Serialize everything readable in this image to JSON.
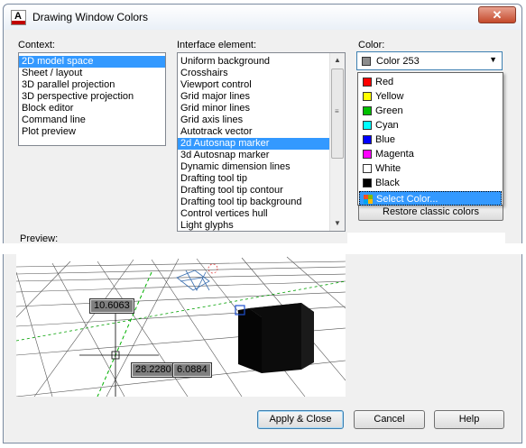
{
  "window": {
    "title": "Drawing Window Colors",
    "close_glyph": "✕",
    "app_icon": "autocad-icon",
    "app_letter": "A"
  },
  "context": {
    "label": "Context:",
    "items": [
      "2D model space",
      "Sheet / layout",
      "3D parallel projection",
      "3D perspective projection",
      "Block editor",
      "Command line",
      "Plot preview"
    ],
    "selected_index": 0
  },
  "interface": {
    "label": "Interface element:",
    "items": [
      "Uniform background",
      "Crosshairs",
      "Viewport control",
      "Grid major lines",
      "Grid minor lines",
      "Grid axis lines",
      "Autotrack vector",
      "2d Autosnap marker",
      "3d Autosnap marker",
      "Dynamic dimension lines",
      "Drafting tool tip",
      "Drafting tool tip contour",
      "Drafting tool tip background",
      "Control vertices hull",
      "Light glyphs"
    ],
    "selected_index": 7
  },
  "color": {
    "label": "Color:",
    "selected": "Color 253",
    "selected_hex": "#8c8c8c",
    "options": [
      {
        "label": "Red",
        "hex": "#ff0000"
      },
      {
        "label": "Yellow",
        "hex": "#ffff00"
      },
      {
        "label": "Green",
        "hex": "#00c000"
      },
      {
        "label": "Cyan",
        "hex": "#00ffff"
      },
      {
        "label": "Blue",
        "hex": "#0000ff"
      },
      {
        "label": "Magenta",
        "hex": "#ff00ff"
      },
      {
        "label": "White",
        "hex": "#ffffff"
      },
      {
        "label": "Black",
        "hex": "#000000"
      }
    ],
    "select_color_label": "Select Color...",
    "restore_label": "Restore classic colors"
  },
  "preview": {
    "label": "Preview:",
    "tooltips": [
      "10.6063",
      "28.2280",
      "6.0884"
    ]
  },
  "buttons": {
    "apply": "Apply & Close",
    "cancel": "Cancel",
    "help": "Help"
  },
  "colors": {
    "selection": "#3399ff",
    "dialog_bg": "#f0f0f0",
    "close_red": "#c44a2c",
    "tooltip_bg": "#7f7f7f"
  }
}
